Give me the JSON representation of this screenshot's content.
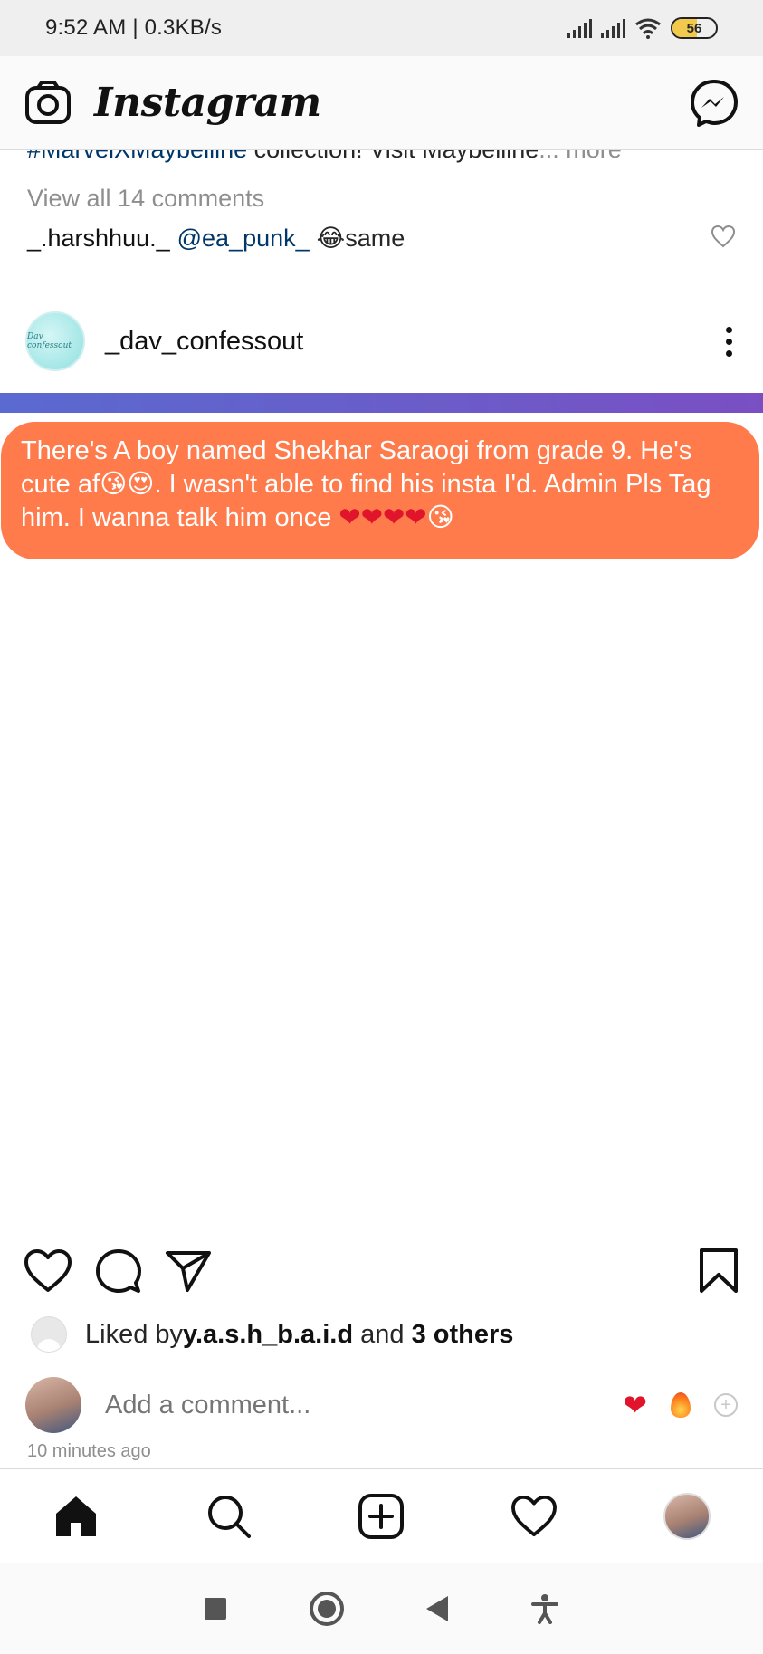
{
  "status_bar": {
    "time": "9:52 AM | 0.3KB/s",
    "battery_level": "56"
  },
  "header": {
    "title": "Instagram",
    "camera_icon": "camera-icon",
    "messenger_icon": "messenger-icon"
  },
  "previous_post": {
    "caption_hashtag": "#MarvelXMaybelline",
    "caption_text": " collection! Visit Maybelline",
    "caption_more": "... more",
    "view_comments": "View all 14 comments",
    "comment": {
      "username": "_.harshhuu._",
      "mention": "@ea_punk_",
      "emoji": "😂",
      "text": "same"
    }
  },
  "post": {
    "username": "_dav_confessout",
    "avatar_text": "Dav confessout",
    "image_text_parts": {
      "line_a": "There's A boy named Shekhar Saraogi from grade 9. He's cute af",
      "emoji_a": "😘😍",
      "line_b": ". I wasn't able to find his insta I'd. Admin Pls Tag him. I wanna talk him once ",
      "hearts": "❤❤❤❤",
      "emoji_b": "😘"
    },
    "likes": {
      "prefix": "Liked by ",
      "user": "y.a.s.h_b.a.i.d",
      "middle": " and ",
      "others": "3 others"
    },
    "add_comment_placeholder": "Add a comment...",
    "timestamp": "10 minutes ago",
    "quick_reactions": [
      "❤",
      "🔥",
      "+"
    ]
  },
  "colors": {
    "bubble": "#ff7b4c",
    "gradient_start": "#5a6ad0",
    "gradient_end": "#7a4fc4",
    "link": "#00376b",
    "muted": "#8e8e8e"
  },
  "bottom_nav": [
    "home-icon",
    "search-icon",
    "new-post-icon",
    "activity-heart-icon",
    "profile-avatar"
  ],
  "system_nav": [
    "recents-button",
    "home-button",
    "back-button",
    "accessibility-button"
  ]
}
